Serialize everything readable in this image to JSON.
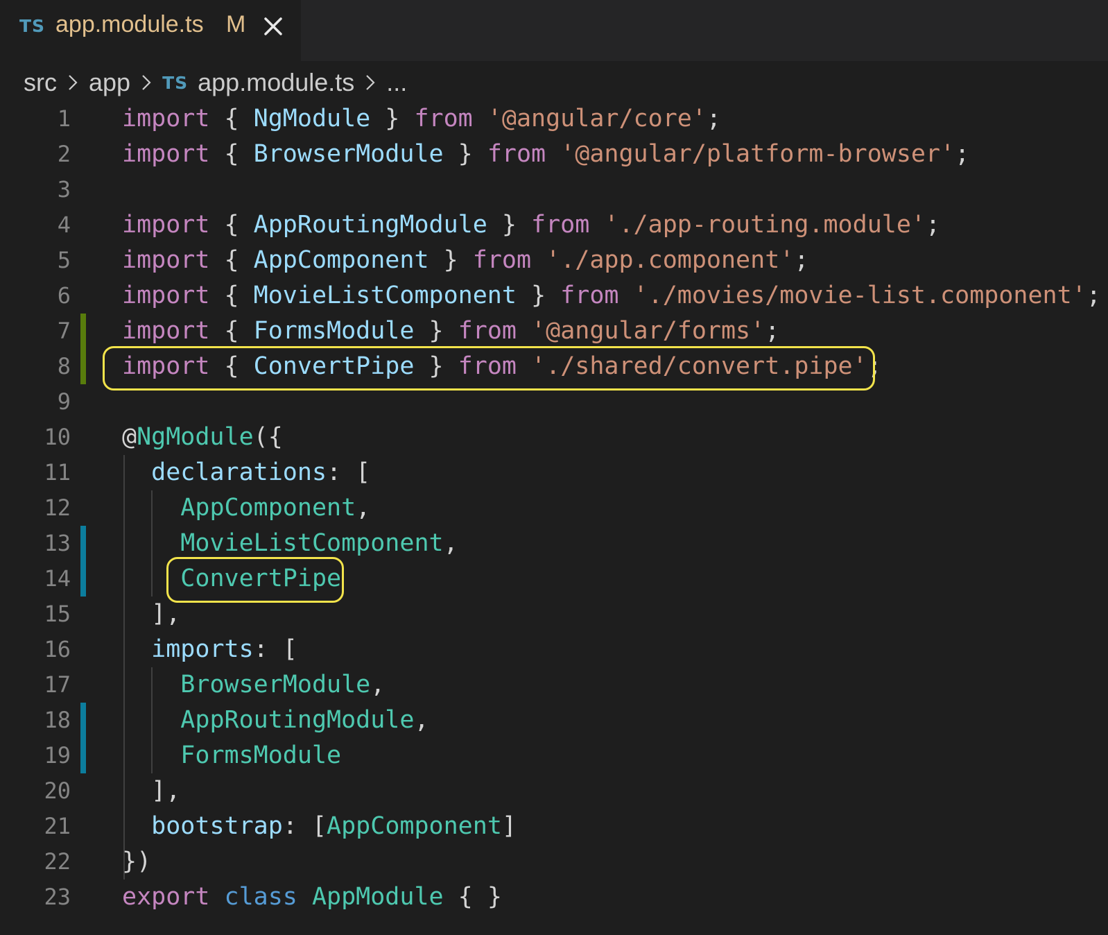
{
  "tab": {
    "lang_badge": "TS",
    "title": "app.module.ts",
    "modified_marker": "M"
  },
  "breadcrumb": {
    "items": [
      "src",
      "app",
      "app.module.ts",
      "..."
    ],
    "file_badge": "TS"
  },
  "colors": {
    "editor_background": "#1e1e1e",
    "highlight_outline": "#f2e34b",
    "git_added": "#587c0c",
    "git_modified": "#0c7d9d"
  },
  "editor": {
    "line_numbers": [
      "1",
      "2",
      "3",
      "4",
      "5",
      "6",
      "7",
      "8",
      "9",
      "10",
      "11",
      "12",
      "13",
      "14",
      "15",
      "16",
      "17",
      "18",
      "19",
      "20",
      "21",
      "22",
      "23"
    ],
    "lines": [
      [
        [
          "kw",
          "import"
        ],
        [
          "pu",
          " { "
        ],
        [
          "id",
          "NgModule"
        ],
        [
          "pu",
          " } "
        ],
        [
          "kw",
          "from"
        ],
        [
          "pu",
          " "
        ],
        [
          "st",
          "'@angular/core'"
        ],
        [
          "pu",
          ";"
        ]
      ],
      [
        [
          "kw",
          "import"
        ],
        [
          "pu",
          " { "
        ],
        [
          "id",
          "BrowserModule"
        ],
        [
          "pu",
          " } "
        ],
        [
          "kw",
          "from"
        ],
        [
          "pu",
          " "
        ],
        [
          "st",
          "'@angular/platform-browser'"
        ],
        [
          "pu",
          ";"
        ]
      ],
      [],
      [
        [
          "kw",
          "import"
        ],
        [
          "pu",
          " { "
        ],
        [
          "id",
          "AppRoutingModule"
        ],
        [
          "pu",
          " } "
        ],
        [
          "kw",
          "from"
        ],
        [
          "pu",
          " "
        ],
        [
          "st",
          "'./app-routing.module'"
        ],
        [
          "pu",
          ";"
        ]
      ],
      [
        [
          "kw",
          "import"
        ],
        [
          "pu",
          " { "
        ],
        [
          "id",
          "AppComponent"
        ],
        [
          "pu",
          " } "
        ],
        [
          "kw",
          "from"
        ],
        [
          "pu",
          " "
        ],
        [
          "st",
          "'./app.component'"
        ],
        [
          "pu",
          ";"
        ]
      ],
      [
        [
          "kw",
          "import"
        ],
        [
          "pu",
          " { "
        ],
        [
          "id",
          "MovieListComponent"
        ],
        [
          "pu",
          " } "
        ],
        [
          "kw",
          "from"
        ],
        [
          "pu",
          " "
        ],
        [
          "st",
          "'./movies/movie-list.component'"
        ],
        [
          "pu",
          ";"
        ]
      ],
      [
        [
          "kw",
          "import"
        ],
        [
          "pu",
          " { "
        ],
        [
          "id",
          "FormsModule"
        ],
        [
          "pu",
          " } "
        ],
        [
          "kw",
          "from"
        ],
        [
          "pu",
          " "
        ],
        [
          "st",
          "'@angular/forms'"
        ],
        [
          "pu",
          ";"
        ]
      ],
      [
        [
          "kw",
          "import"
        ],
        [
          "pu",
          " { "
        ],
        [
          "id",
          "ConvertPipe"
        ],
        [
          "pu",
          " } "
        ],
        [
          "kw",
          "from"
        ],
        [
          "pu",
          " "
        ],
        [
          "st",
          "'./shared/convert.pipe'"
        ],
        [
          "pu",
          ";"
        ]
      ],
      [],
      [
        [
          "pu",
          "@"
        ],
        [
          "fn",
          "NgModule"
        ],
        [
          "pu",
          "({"
        ]
      ],
      [
        [
          "pu",
          "  "
        ],
        [
          "id",
          "declarations"
        ],
        [
          "pu",
          ": ["
        ]
      ],
      [
        [
          "pu",
          "    "
        ],
        [
          "ty",
          "AppComponent"
        ],
        [
          "pu",
          ","
        ]
      ],
      [
        [
          "pu",
          "    "
        ],
        [
          "ty",
          "MovieListComponent"
        ],
        [
          "pu",
          ","
        ]
      ],
      [
        [
          "pu",
          "    "
        ],
        [
          "ty",
          "ConvertPipe"
        ]
      ],
      [
        [
          "pu",
          "  ],"
        ]
      ],
      [
        [
          "pu",
          "  "
        ],
        [
          "id",
          "imports"
        ],
        [
          "pu",
          ": ["
        ]
      ],
      [
        [
          "pu",
          "    "
        ],
        [
          "ty",
          "BrowserModule"
        ],
        [
          "pu",
          ","
        ]
      ],
      [
        [
          "pu",
          "    "
        ],
        [
          "ty",
          "AppRoutingModule"
        ],
        [
          "pu",
          ","
        ]
      ],
      [
        [
          "pu",
          "    "
        ],
        [
          "ty",
          "FormsModule"
        ]
      ],
      [
        [
          "pu",
          "  ],"
        ]
      ],
      [
        [
          "pu",
          "  "
        ],
        [
          "id",
          "bootstrap"
        ],
        [
          "pu",
          ": ["
        ],
        [
          "ty",
          "AppComponent"
        ],
        [
          "pu",
          "]"
        ]
      ],
      [
        [
          "pu",
          "})"
        ]
      ],
      [
        [
          "kw",
          "export"
        ],
        [
          "pu",
          " "
        ],
        [
          "bl",
          "class"
        ],
        [
          "pu",
          " "
        ],
        [
          "ty",
          "AppModule"
        ],
        [
          "pu",
          " { }"
        ]
      ]
    ]
  }
}
